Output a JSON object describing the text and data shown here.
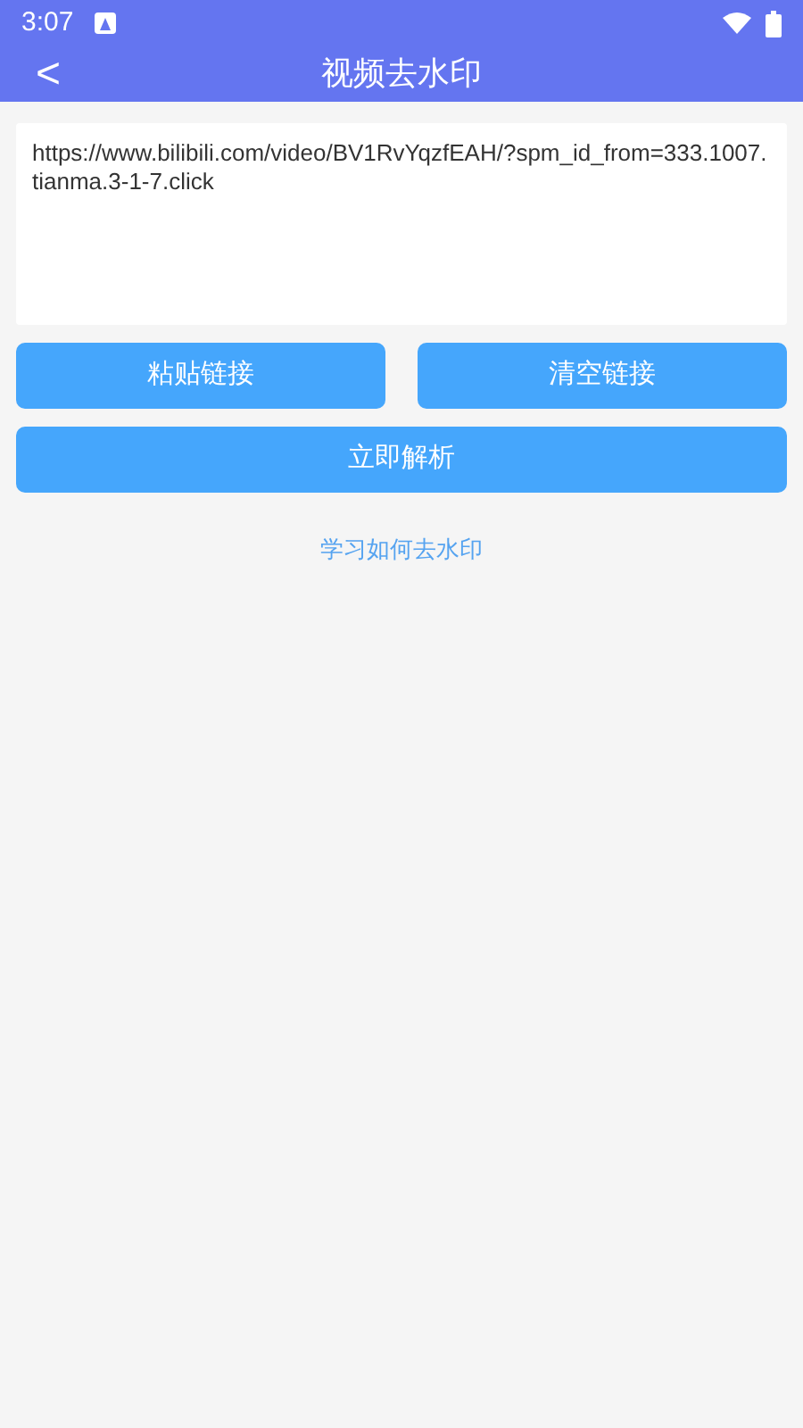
{
  "status_bar": {
    "time": "3:07"
  },
  "app_bar": {
    "back": "<",
    "title": "视频去水印"
  },
  "url_field": {
    "value": "https://www.bilibili.com/video/BV1RvYqzfEAH/?spm_id_from=333.1007.tianma.3-1-7.click"
  },
  "buttons": [
    {
      "label": "粘贴链接"
    },
    {
      "label": "清空链接"
    }
  ],
  "primary_button": {
    "label": "立即解析"
  },
  "help_link": {
    "label": "学习如何去水印"
  }
}
